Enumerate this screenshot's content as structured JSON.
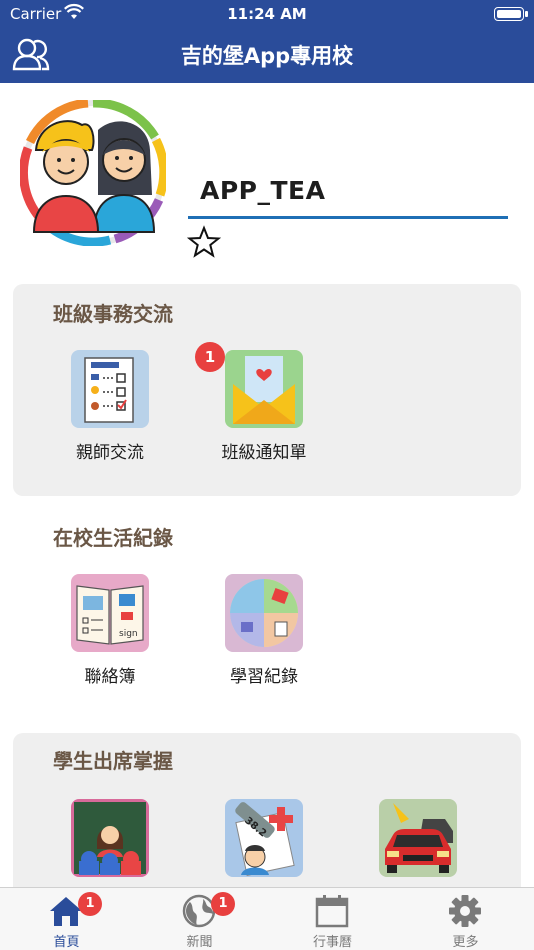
{
  "status": {
    "carrier": "Carrier",
    "time": "11:24 AM"
  },
  "nav": {
    "title": "吉的堡App專用校"
  },
  "profile": {
    "username": "APP_TEA",
    "star": "☆"
  },
  "sections": [
    {
      "title": "班級事務交流",
      "items": [
        {
          "label": "親師交流",
          "badge": ""
        },
        {
          "label": "班級通知單",
          "badge": "1"
        }
      ]
    },
    {
      "title": "在校生活紀錄",
      "items": [
        {
          "label": "聯絡簿",
          "badge": ""
        },
        {
          "label": "學習紀錄",
          "badge": ""
        }
      ]
    },
    {
      "title": "學生出席掌握",
      "items": [
        {
          "label": "",
          "badge": ""
        },
        {
          "label": "",
          "badge": ""
        },
        {
          "label": "",
          "badge": ""
        }
      ]
    }
  ],
  "tabs": [
    {
      "label": "首頁",
      "badge": "1",
      "icon": "home-icon"
    },
    {
      "label": "新聞",
      "badge": "1",
      "icon": "globe-icon"
    },
    {
      "label": "行事曆",
      "badge": "",
      "icon": "calendar-icon"
    },
    {
      "label": "更多",
      "badge": "",
      "icon": "gear-icon"
    }
  ],
  "colors": {
    "nav": "#2a4c9a",
    "badge": "#e8403f",
    "section_title": "#6a5746",
    "active_tab": "#2a4c9a"
  }
}
